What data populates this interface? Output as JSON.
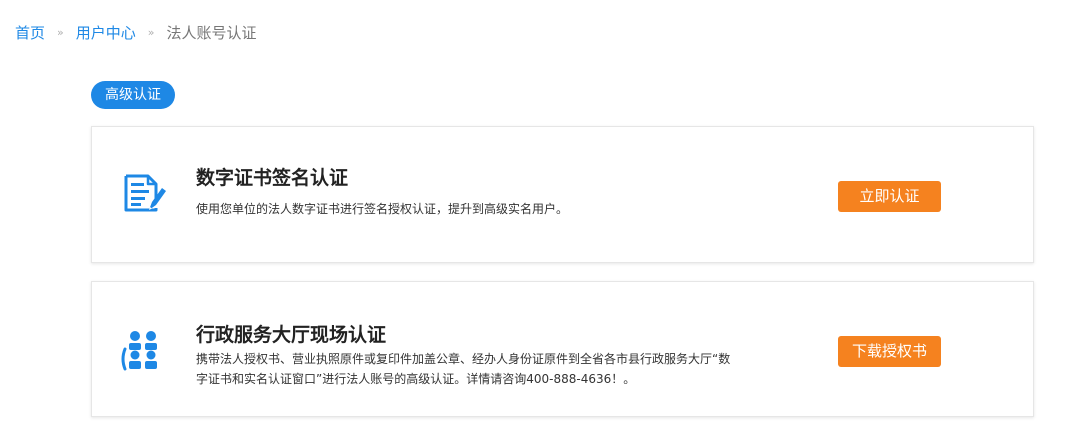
{
  "breadcrumb": {
    "home": "首页",
    "separator_1": "»",
    "user_center": "用户中心",
    "separator_2": "»",
    "current": "法人账号认证"
  },
  "level_badge": "高级认证",
  "cards": [
    {
      "icon": "certificate-sign-icon",
      "title": "数字证书签名认证",
      "description": "使用您单位的法人数字证书进行签名授权认证，提升到高级实名用户。",
      "button": "立即认证"
    },
    {
      "icon": "service-hall-people-icon",
      "title": "行政服务大厅现场认证",
      "description": "携带法人授权书、营业执照原件或复印件加盖公章、经办人身份证原件到全省各市县行政服务大厅“数字证书和实名认证窗口”进行法人账号的高级认证。详情请咨询400-888-4636！。",
      "button": "下载授权书"
    }
  ],
  "colors": {
    "primary_blue": "#1e88e5",
    "action_orange": "#f5821f",
    "icon_blue": "#1e88e5"
  }
}
